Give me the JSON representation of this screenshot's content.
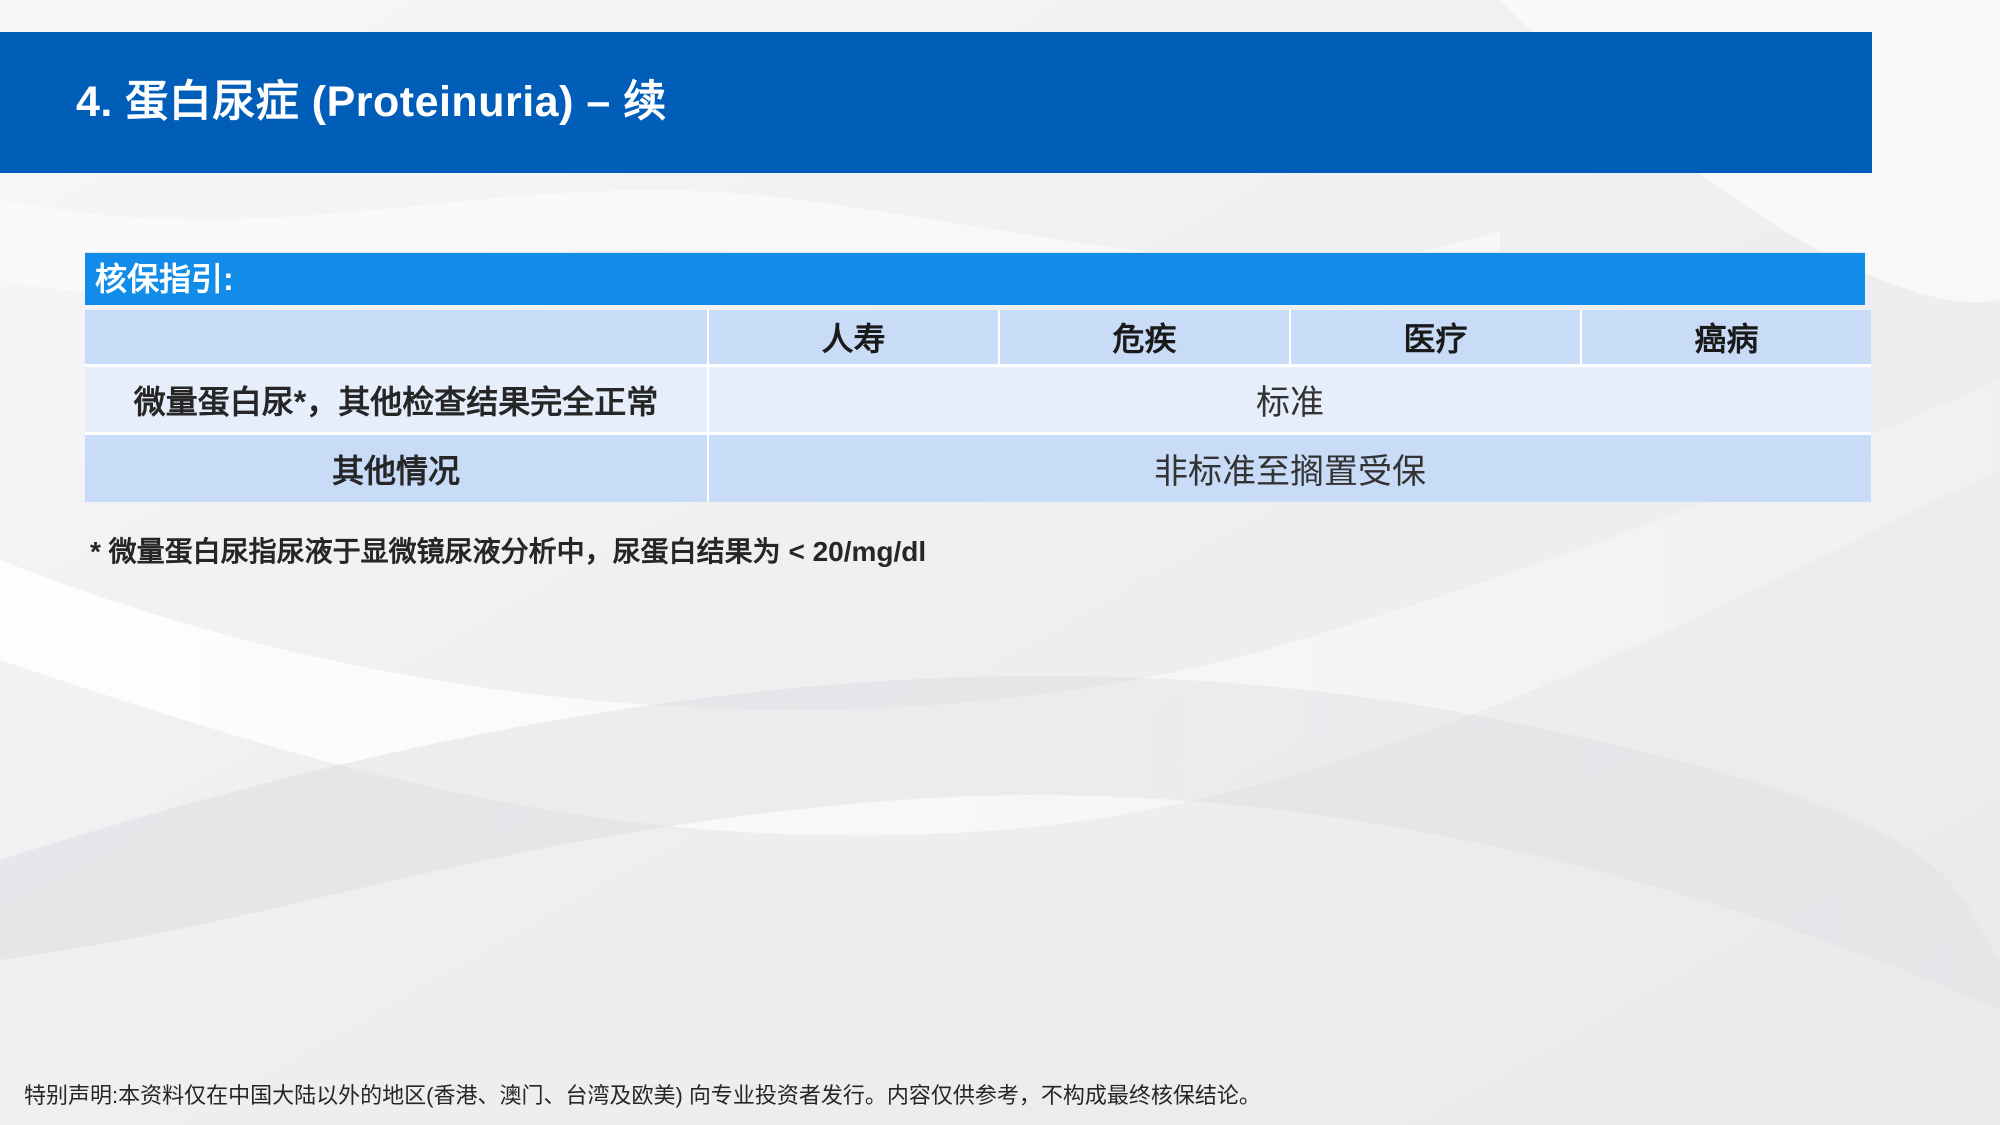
{
  "title": "4. 蛋白尿症 (Proteinuria) – 续",
  "guide": {
    "label": "核保指引:"
  },
  "table": {
    "columns": [
      "",
      "人寿",
      "危疾",
      "医疗",
      "癌病"
    ],
    "rows": [
      {
        "label": "微量蛋白尿*，其他检查结果完全正常",
        "value": "标准"
      },
      {
        "label": "其他情况",
        "value": "非标准至搁置受保"
      }
    ]
  },
  "footnote": "* 微量蛋白尿指尿液于显微镜尿液分析中，尿蛋白结果为 < 20/mg/dl",
  "disclaimer": "特别声明:本资料仅在中国大陆以外的地区(香港、澳门、台湾及欧美) 向专业投资者发行。内容仅供参考，不构成最终核保结论。",
  "colors": {
    "title_bar": "#005eb8",
    "guide_header": "#118ce9",
    "header_row": "#c8dbf7",
    "light_row": "#e6eefb"
  }
}
